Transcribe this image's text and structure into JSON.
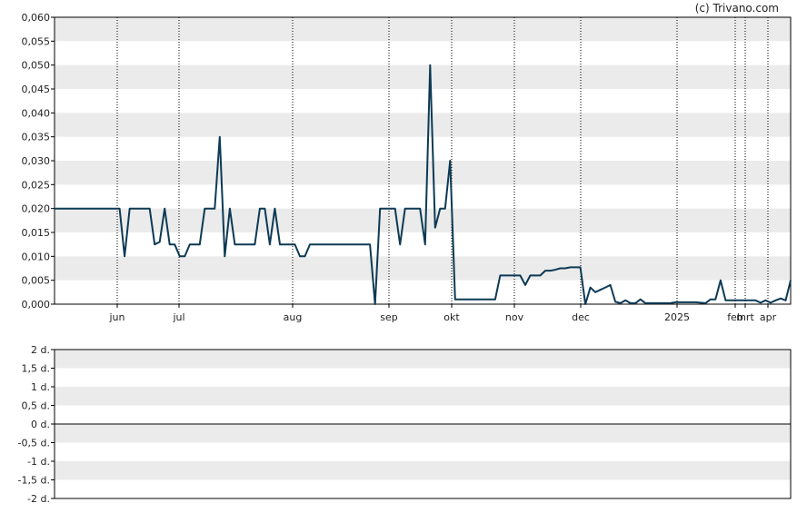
{
  "credit": "(c) Trivano.com",
  "colors": {
    "line": "#0d3a55",
    "band": "#ebebeb",
    "grid": "#000000",
    "axis": "#000000"
  },
  "chart_data": [
    {
      "type": "line",
      "title": "",
      "ylim": [
        0,
        0.06
      ],
      "yticks": [
        "0,000",
        "0,005",
        "0,010",
        "0,015",
        "0,020",
        "0,025",
        "0,030",
        "0,035",
        "0,040",
        "0,045",
        "0,050",
        "0,055",
        "0,060"
      ],
      "xticks": [
        "jun",
        "jul",
        "aug",
        "sep",
        "okt",
        "nov",
        "dec",
        "2025",
        "feb",
        "mrt",
        "apr"
      ],
      "grid": {
        "bands": true,
        "vertical_dotted": true
      },
      "series": [
        {
          "values": [
            0.02,
            0.02,
            0.02,
            0.02,
            0.02,
            0.02,
            0.02,
            0.02,
            0.02,
            0.02,
            0.02,
            0.02,
            0.02,
            0.02,
            0.01,
            0.02,
            0.02,
            0.02,
            0.02,
            0.02,
            0.0125,
            0.013,
            0.02,
            0.0125,
            0.0125,
            0.01,
            0.01,
            0.0125,
            0.0125,
            0.0125,
            0.02,
            0.02,
            0.02,
            0.035,
            0.01,
            0.02,
            0.0125,
            0.0125,
            0.0125,
            0.0125,
            0.0125,
            0.02,
            0.02,
            0.0125,
            0.02,
            0.0125,
            0.0125,
            0.0125,
            0.0125,
            0.01,
            0.01,
            0.0125,
            0.0125,
            0.0125,
            0.0125,
            0.0125,
            0.0125,
            0.0125,
            0.0125,
            0.0125,
            0.0125,
            0.0125,
            0.0125,
            0.0125,
            0.0,
            0.02,
            0.02,
            0.02,
            0.02,
            0.0125,
            0.02,
            0.02,
            0.02,
            0.02,
            0.0125,
            0.05,
            0.016,
            0.02,
            0.02,
            0.03,
            0.001,
            0.001,
            0.001,
            0.001,
            0.001,
            0.001,
            0.001,
            0.001,
            0.001,
            0.006,
            0.006,
            0.006,
            0.006,
            0.006,
            0.004,
            0.006,
            0.006,
            0.006,
            0.007,
            0.007,
            0.0072,
            0.0075,
            0.0075,
            0.0077,
            0.0077,
            0.0077,
            0.0,
            0.0035,
            0.0025,
            0.003,
            0.0035,
            0.004,
            0.0005,
            0.0002,
            0.0008,
            0.0002,
            0.0002,
            0.001,
            0.0002,
            0.0002,
            0.0002,
            0.0002,
            0.0002,
            0.0002,
            0.0004,
            0.0004,
            0.0004,
            0.0004,
            0.0004,
            0.0003,
            0.0002,
            0.001,
            0.001,
            0.005,
            0.0008,
            0.0008,
            0.0008,
            0.0008,
            0.0008,
            0.0008,
            0.0008,
            0.0003,
            0.0008,
            0.0003,
            0.0008,
            0.0012,
            0.0008,
            0.005
          ]
        }
      ]
    },
    {
      "type": "line",
      "title": "",
      "ylim": [
        -2,
        2
      ],
      "yticks": [
        "-2 d.",
        "-1,5 d.",
        "-1 d.",
        "-0,5 d.",
        "0 d.",
        "0,5 d.",
        "1 d.",
        "1,5 d.",
        "2 d."
      ],
      "grid": {
        "bands": true,
        "zero_line": true
      },
      "series": []
    }
  ]
}
